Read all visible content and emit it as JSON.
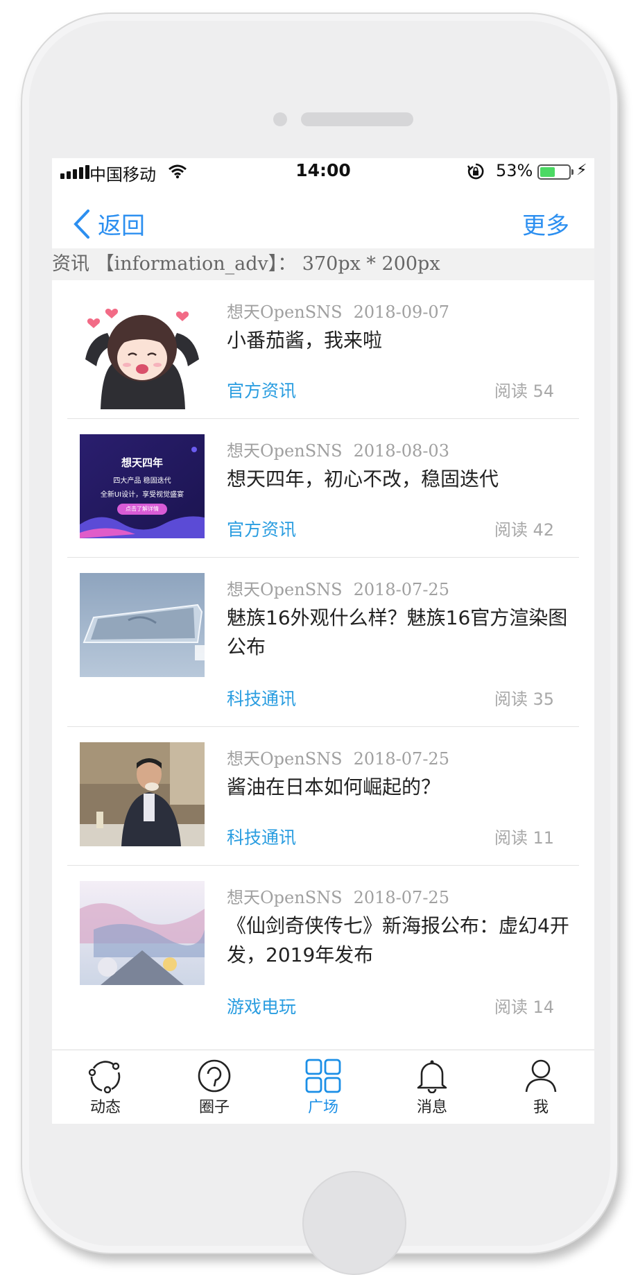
{
  "status_bar": {
    "carrier": "中国移动",
    "time": "14:00",
    "battery_percent": "53%",
    "battery_level": 0.53
  },
  "nav": {
    "back_label": "返回",
    "more_label": "更多"
  },
  "adv_banner": "资讯 【information_adv】： 370px * 200px",
  "articles": [
    {
      "author": "想天OpenSNS",
      "date": "2018-09-07",
      "title": "小番茄酱，我来啦",
      "category": "官方资讯",
      "reads": "阅读 54"
    },
    {
      "author": "想天OpenSNS",
      "date": "2018-08-03",
      "title": "想天四年，初心不改，稳固迭代",
      "category": "官方资讯",
      "reads": "阅读 42",
      "thumb_text": {
        "headline": "想天四年",
        "line1": "四大产品 稳固迭代",
        "line2": "全新UI设计，享受视觉盛宴",
        "button": "点击了解详情"
      }
    },
    {
      "author": "想天OpenSNS",
      "date": "2018-07-25",
      "title": "魅族16外观什么样？魅族16官方渲染图公布",
      "category": "科技通讯",
      "reads": "阅读 35"
    },
    {
      "author": "想天OpenSNS",
      "date": "2018-07-25",
      "title": "酱油在日本如何崛起的？",
      "category": "科技通讯",
      "reads": "阅读 11"
    },
    {
      "author": "想天OpenSNS",
      "date": "2018-07-25",
      "title": "《仙剑奇侠传七》新海报公布：虚幻4开发，2019年发布",
      "category": "游戏电玩",
      "reads": "阅读 14"
    }
  ],
  "tabs": [
    {
      "label": "动态",
      "icon": "activity-icon"
    },
    {
      "label": "圈子",
      "icon": "circle-icon"
    },
    {
      "label": "广场",
      "icon": "grid-icon",
      "active": true
    },
    {
      "label": "消息",
      "icon": "bell-icon"
    },
    {
      "label": "我",
      "icon": "user-icon"
    }
  ],
  "colors": {
    "accent": "#2c8ff0",
    "tag": "#2a9de0",
    "active_tab": "#1b8fe6"
  }
}
